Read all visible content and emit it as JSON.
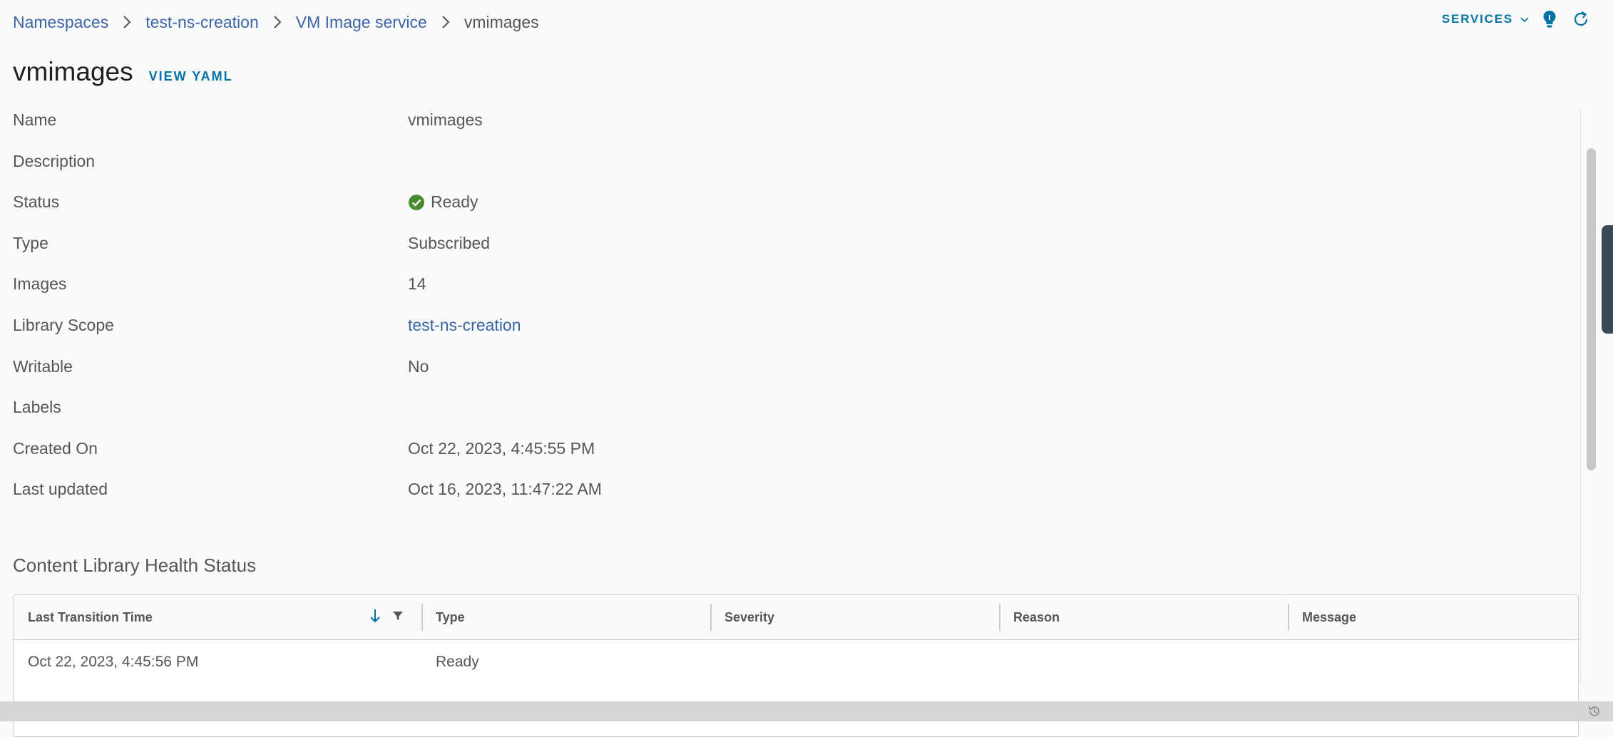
{
  "breadcrumb": {
    "items": [
      "Namespaces",
      "test-ns-creation",
      "VM Image service"
    ],
    "current": "vmimages"
  },
  "header": {
    "services_label": "SERVICES",
    "title": "vmimages",
    "view_yaml_label": "VIEW YAML"
  },
  "properties": {
    "name": {
      "label": "Name",
      "value": "vmimages"
    },
    "description": {
      "label": "Description",
      "value": ""
    },
    "status": {
      "label": "Status",
      "value": "Ready",
      "icon": "check-circle-icon",
      "color": "#4a8a2f"
    },
    "type": {
      "label": "Type",
      "value": "Subscribed"
    },
    "images": {
      "label": "Images",
      "value": "14"
    },
    "library_scope": {
      "label": "Library Scope",
      "value": "test-ns-creation"
    },
    "writable": {
      "label": "Writable",
      "value": "No"
    },
    "labels": {
      "label": "Labels",
      "value": ""
    },
    "created_on": {
      "label": "Created On",
      "value": "Oct 22, 2023, 4:45:55 PM"
    },
    "last_updated": {
      "label": "Last updated",
      "value": "Oct 16, 2023, 11:47:22 AM"
    }
  },
  "health": {
    "title": "Content Library Health Status",
    "columns": [
      "Last Transition Time",
      "Type",
      "Severity",
      "Reason",
      "Message"
    ],
    "rows": [
      {
        "time": "Oct 22, 2023, 4:45:56 PM",
        "type": "Ready",
        "severity": "",
        "reason": "",
        "message": ""
      }
    ]
  },
  "colors": {
    "link": "#3a66a8",
    "accent": "#0072a3",
    "support_tab": "#3b4a56"
  }
}
